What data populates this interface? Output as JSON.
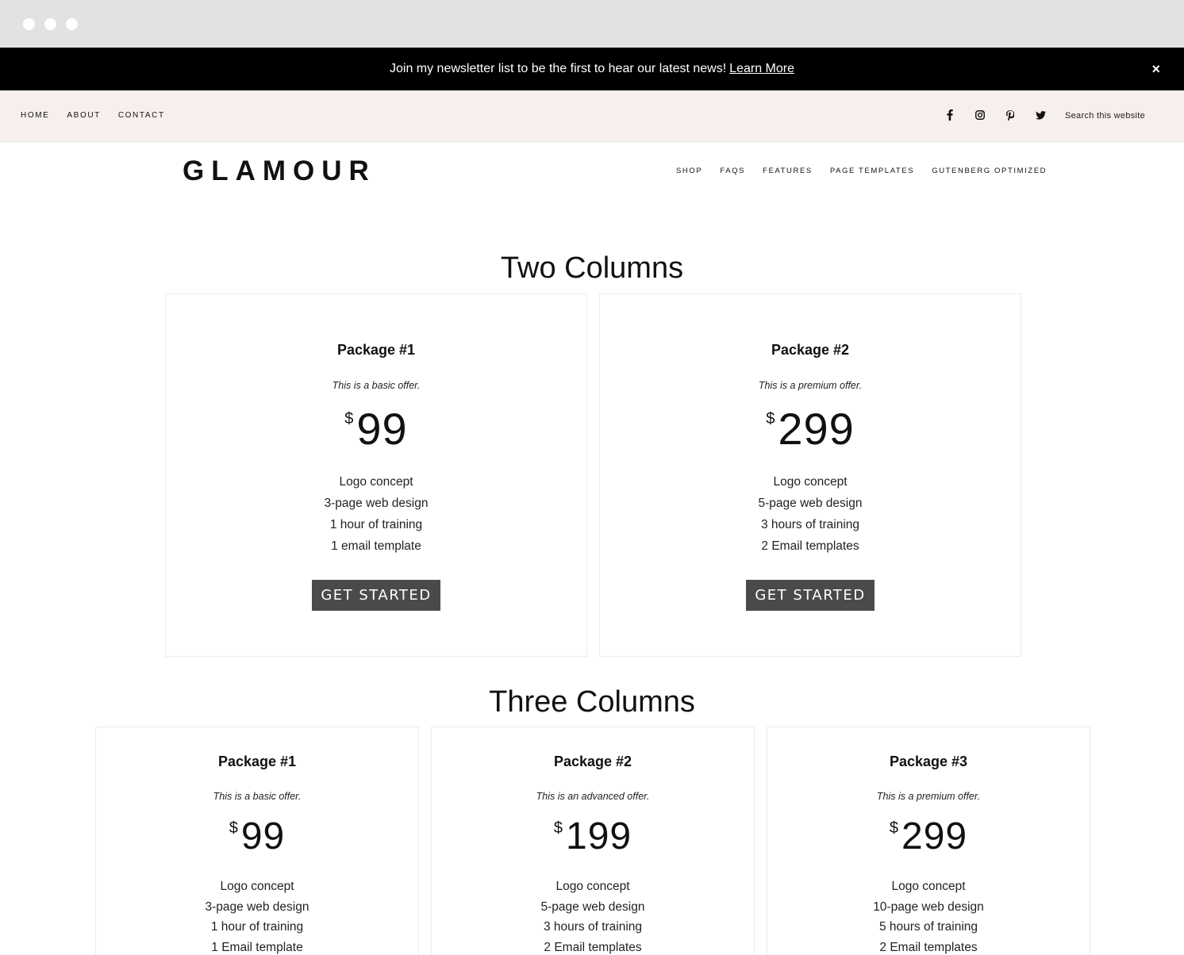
{
  "announcement": {
    "text": "Join my newsletter list to be the first to hear our latest news!",
    "link_label": "Learn More",
    "close_label": "×"
  },
  "utility_nav": {
    "items": [
      "HOME",
      "ABOUT",
      "CONTACT"
    ],
    "social_icons": [
      "facebook-icon",
      "instagram-icon",
      "pinterest-icon",
      "twitter-icon"
    ],
    "search_placeholder": "Search this website"
  },
  "site": {
    "logo": "GLAMOUR"
  },
  "main_nav": {
    "items": [
      "SHOP",
      "FAQS",
      "FEATURES",
      "PAGE TEMPLATES",
      "GUTENBERG OPTIMIZED"
    ]
  },
  "two_columns": {
    "title": "Two Columns",
    "packages": [
      {
        "title": "Package #1",
        "subtitle": "This is a basic offer.",
        "currency": "$",
        "price": "99",
        "features": [
          "Logo concept",
          "3-page web design",
          "1 hour of training",
          "1 email template"
        ],
        "button": "GET STARTED"
      },
      {
        "title": "Package #2",
        "subtitle": "This is a premium offer.",
        "currency": "$",
        "price": "299",
        "features": [
          "Logo concept",
          "5-page web design",
          "3 hours of training",
          "2 Email templates"
        ],
        "button": "GET STARTED"
      }
    ]
  },
  "three_columns": {
    "title": "Three Columns",
    "packages": [
      {
        "title": "Package #1",
        "subtitle": "This is a basic offer.",
        "currency": "$",
        "price": "99",
        "features": [
          "Logo concept",
          "3-page web design",
          "1 hour of training",
          "1 Email template"
        ]
      },
      {
        "title": "Package #2",
        "subtitle": "This is an advanced offer.",
        "currency": "$",
        "price": "199",
        "features": [
          "Logo concept",
          "5-page web design",
          "3 hours of training",
          "2 Email templates"
        ]
      },
      {
        "title": "Package #3",
        "subtitle": "This is a premium offer.",
        "currency": "$",
        "price": "299",
        "features": [
          "Logo concept",
          "10-page web design",
          "5 hours of training",
          "2 Email templates"
        ]
      }
    ]
  }
}
